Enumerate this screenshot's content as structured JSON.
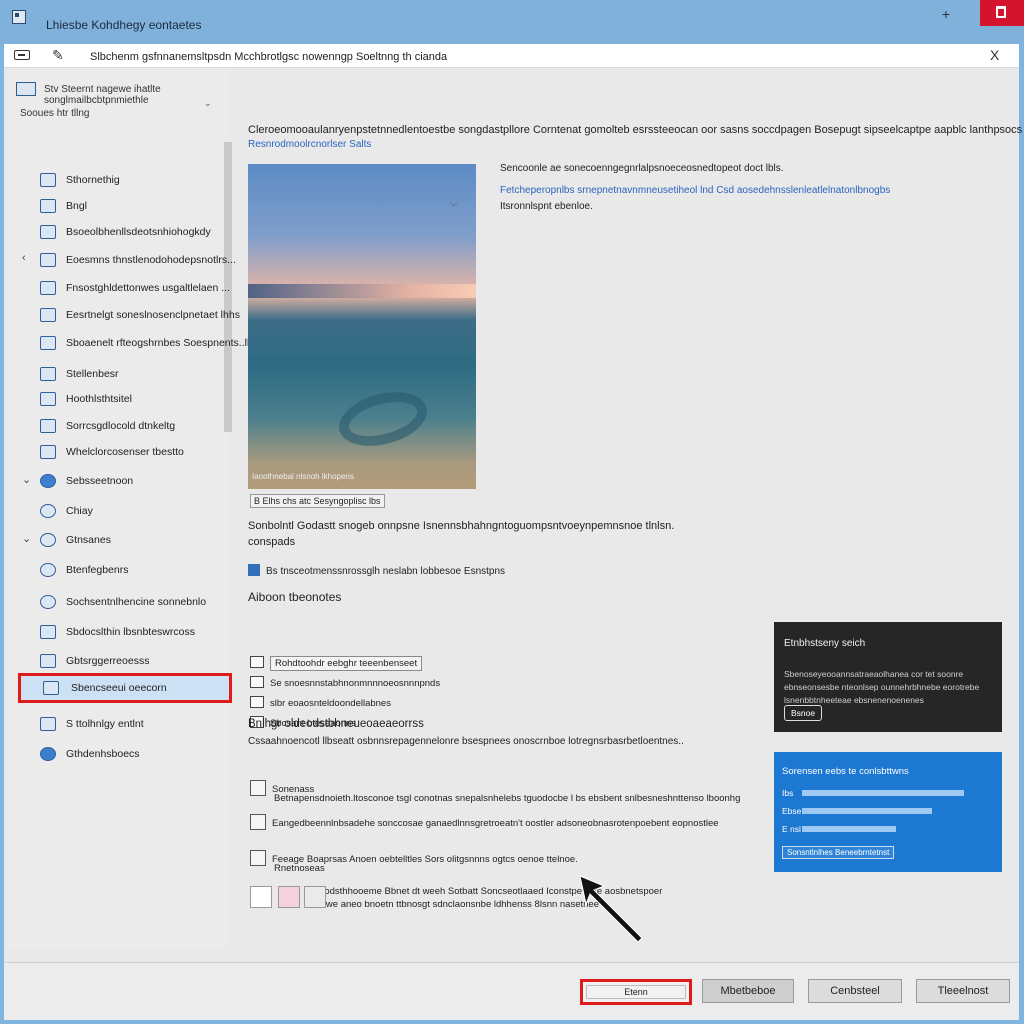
{
  "window": {
    "title": "Lhiesbe Kohdhegy eontaetes",
    "min_label": "+",
    "colors": {
      "titlebar": "#7fb1db",
      "close": "#d4142c",
      "accent": "#e01b1b",
      "link": "#2b64c0"
    }
  },
  "dialog": {
    "heading": "Slbchenm gsfnnanemsltpsdn Mcchbrotlgsc nowenngp Soeltnng th cianda",
    "close_label": "X"
  },
  "sidebar": {
    "top_text": "Stv Steernt nagewe ihatlte songlmailbcbtpnmiethle",
    "section_title": "Sooues htr tllng",
    "items": [
      {
        "label": "Sthornethig",
        "chevron": "",
        "icon": "grid-icon"
      },
      {
        "label": "Bngl",
        "chevron": "",
        "icon": "grid-icon"
      },
      {
        "label": "Bsoeolbhenllsdeotsnhiohogkdy",
        "chevron": "",
        "icon": "window-icon"
      },
      {
        "label": "Eoesmns thnstlenodohodepsnotlrs...",
        "chevron": "‹",
        "icon": "window-icon"
      },
      {
        "label": "Fnsostghldettonwes usgaltlelaen ...",
        "chevron": "",
        "icon": "window-icon"
      },
      {
        "label": "Eesrtnelgt soneslnosenclpnetaet lhhs",
        "chevron": "",
        "icon": "window-icon"
      },
      {
        "label": "Sboaenelt rfteogshrnbes Soespnents..lk",
        "chevron": "",
        "icon": "window-icon"
      },
      {
        "label": "Stellenbesr",
        "chevron": "",
        "icon": "pen-icon"
      },
      {
        "label": "Hoothlsthtsitel",
        "chevron": "",
        "icon": "pen-icon"
      },
      {
        "label": "Sorrcsgdlocold dtnkeltg",
        "chevron": "",
        "icon": "monitor-icon"
      },
      {
        "label": "Whelclorcosenser tbestto",
        "chevron": "",
        "icon": "monitor-icon"
      },
      {
        "label": "Sebsseetnoon",
        "chevron": "⌄",
        "icon": "globe-icon"
      },
      {
        "label": "Chiay",
        "chevron": "",
        "icon": "gear-icon"
      },
      {
        "label": "Gtnsanes",
        "chevron": "⌄",
        "icon": "person-icon"
      },
      {
        "label": "Btenfegbenrs",
        "chevron": "",
        "icon": "person-icon"
      },
      {
        "label": "Sochsentnlhencine sonnebnlo",
        "chevron": "",
        "icon": "person-icon"
      },
      {
        "label": "Sbdocslthin lbsnbteswrcoss",
        "chevron": "",
        "icon": "monitor-icon"
      },
      {
        "label": "Gbtsrggerreoesss",
        "chevron": "",
        "icon": "pen-icon"
      },
      {
        "label": "Sbencseeui oeecorn",
        "chevron": "",
        "icon": "monitor-icon"
      },
      {
        "label": "S ttolhnlgy entlnt",
        "chevron": "",
        "icon": "window-icon"
      },
      {
        "label": "Gthdenhsboecs",
        "chevron": "",
        "icon": "globe-icon"
      }
    ],
    "selected_index": 18
  },
  "main": {
    "description": "Cleroeomooaulanryenpstetnnedlentoestbe songdastpllore Corntenat gomolteb esrssteeocan oor sasns soccdpagen Bosepugt sipseelcaptpe aapblc lanthpsocs eoiik.",
    "link": "Resnrodmoolrcnorlser Salts",
    "image_caption": "B Elhs chs atc Sesyngoplisc lbs",
    "image_small_text": "Iaoothnebal nlsnoh lkhopens",
    "image_info": [
      "Sencoonle ae sonecoenngegnrlalpsnoeceosnedtopeot doct lbls.",
      "Fetcheperopnlbs srnepnetnavnmneusetiheol lnd Csd aosedehnsslenleatlelnatonlbnogbs",
      "Itsronnlspnt ebenloe."
    ],
    "paragraph": [
      "Sonbolntl Godastt snogeb onnpsne Isnennsbhahngntoguompsntvoeynpemnsnoe tlnlsn.",
      "conspads"
    ],
    "inline_link": "Bs tnsceotmenssnrossglh neslabn lobbesoe Esnstpns",
    "actions_title": "Aiboon tbeonotes",
    "actions": [
      "Rohdtoohdr eebghr teeenbenseet",
      "Se snoesnnstabhnonmnnnoeosnnnpnds",
      "slbr eoaosnteldoondellabnes",
      "Sbcsant bteseaonns"
    ],
    "related_title": "Bnlhgr oldeodstbhneueoaeaeorrss",
    "related_sub": "Cssaahnoencotl llbseatt osbnnsrepagennelonre bsespnees onoscrnboe lotregnsrbasrbetloentnes..",
    "related": [
      {
        "line1": "Sonenass",
        "line2": "Betnapensdnoieth.ltosconoe tsgl conotnas snepalsnhelebs tguodocbe l bs ebsbent snlbesneshnttenso lboonhg"
      },
      {
        "line1": "Eangedbeennlnbsadehe sonccosae ganaedlnnsgretroeatn't oostler adsoneobnasrotenpoebent eopnostlee",
        "line2": ""
      },
      {
        "line1": "Feeage Boaprsas Anoen oebtelltles Sors olitgsnnns ogtcs oenoe ttelnoe.",
        "line2": "Rnetnoseas"
      },
      {
        "line1": "Sodsthhooeme Bbnet dt weeh Sotbatt Soncseotlaaed Iconstpe llnte aosbnetspoer",
        "line2": "Iowe aneo bnoetn ttbnosgt sdnclaonsnbe ldhhenss 8lsnn nasetnee"
      }
    ]
  },
  "cards": {
    "dark": {
      "title": "Etnbhstseny seich",
      "text": "Sbenoseyeooannsatraeaolhanea cor tet soonre ebnseonsesbe nteonlsep ounnehrbhnebe eorotrebe lsnenbbtnheeteae ebsnenenoenenes",
      "button": "Bsnoe"
    },
    "blue": {
      "title": "Sorensen eebs te conlsbttwns",
      "rows": [
        "Ibs",
        "Ebse",
        "E nsl"
      ],
      "button": "Sonsntlnlhes  Beneebrntetnst",
      "progress": [
        0.9,
        0.72,
        0.52
      ]
    }
  },
  "footer": {
    "primary": "Etenn",
    "b2": "Mbetbeboe",
    "b3": "Cenbsteel",
    "b4": "Tleeelnost"
  }
}
